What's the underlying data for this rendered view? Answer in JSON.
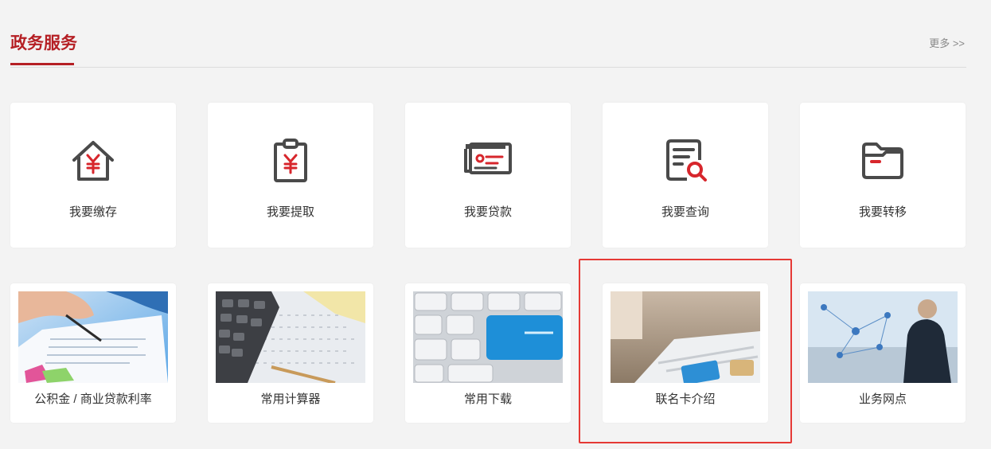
{
  "section": {
    "title": "政务服务",
    "more_label": "更多 >>"
  },
  "services": [
    {
      "label": "我要缴存",
      "icon": "house-yuan-icon"
    },
    {
      "label": "我要提取",
      "icon": "clipboard-yuan-icon"
    },
    {
      "label": "我要贷款",
      "icon": "cards-loan-icon"
    },
    {
      "label": "我要查询",
      "icon": "document-search-icon"
    },
    {
      "label": "我要转移",
      "icon": "folder-transfer-icon"
    }
  ],
  "features": [
    {
      "label": "公积金 / 商业贷款利率",
      "image": "document-signing-photo"
    },
    {
      "label": "常用计算器",
      "image": "calculator-photo"
    },
    {
      "label": "常用下载",
      "image": "keyboard-download-photo"
    },
    {
      "label": "联名卡介绍",
      "image": "keyboard-card-photo"
    },
    {
      "label": "业务网点",
      "image": "network-businessman-photo"
    }
  ],
  "colors": {
    "accent": "#b51f24",
    "icon_gray": "#4a4a4a",
    "icon_red": "#d7262c",
    "highlight": "#e53935"
  }
}
